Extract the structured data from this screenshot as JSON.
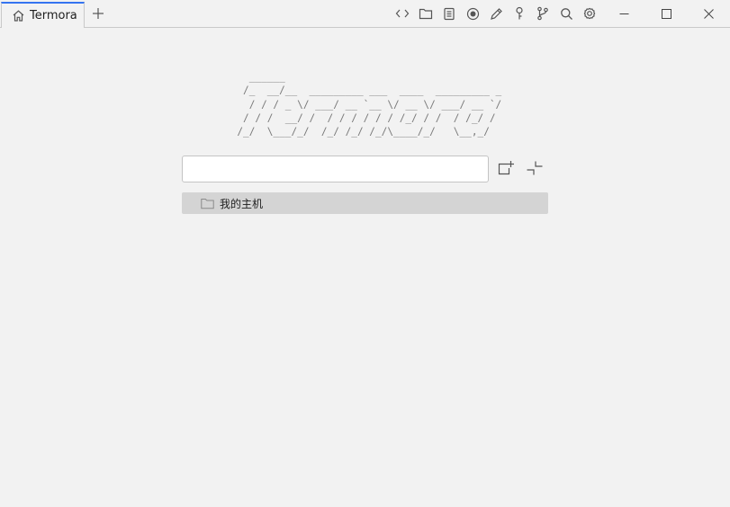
{
  "tab": {
    "label": "Termora",
    "icon": "home-icon"
  },
  "new_tab": {
    "icon": "plus-icon"
  },
  "toolbar": {
    "icons": [
      "code-icon",
      "folder-icon",
      "notes-icon",
      "record-icon",
      "pen-icon",
      "key-icon",
      "git-branch-icon",
      "search-icon",
      "gear-icon"
    ]
  },
  "window_controls": {
    "icons": [
      "minimize-icon",
      "maximize-icon",
      "close-icon"
    ]
  },
  "logo": {
    "ascii": "    ______\n   /_  __/__  _________ ___  ____  _________ _\n    / / / _ \\/ ___/ __ `__ \\/ __ \\/ ___/ __ `/\n   / / /  __/ /  / / / / / / /_/ / /  / /_/ /\n  /_/  \\___/_/  /_/ /_/ /_/\\____/_/   \\__,_/"
  },
  "search": {
    "value": "",
    "placeholder": ""
  },
  "actions": {
    "add_host_icon": "add-host-icon",
    "collapse_icon": "collapse-icon"
  },
  "tree": {
    "items": [
      {
        "label": "我的主机",
        "icon": "folder-icon",
        "selected": true
      }
    ]
  },
  "colors": {
    "accent": "#3574f0",
    "background": "#f2f2f2",
    "selection": "#d4d4d4"
  }
}
